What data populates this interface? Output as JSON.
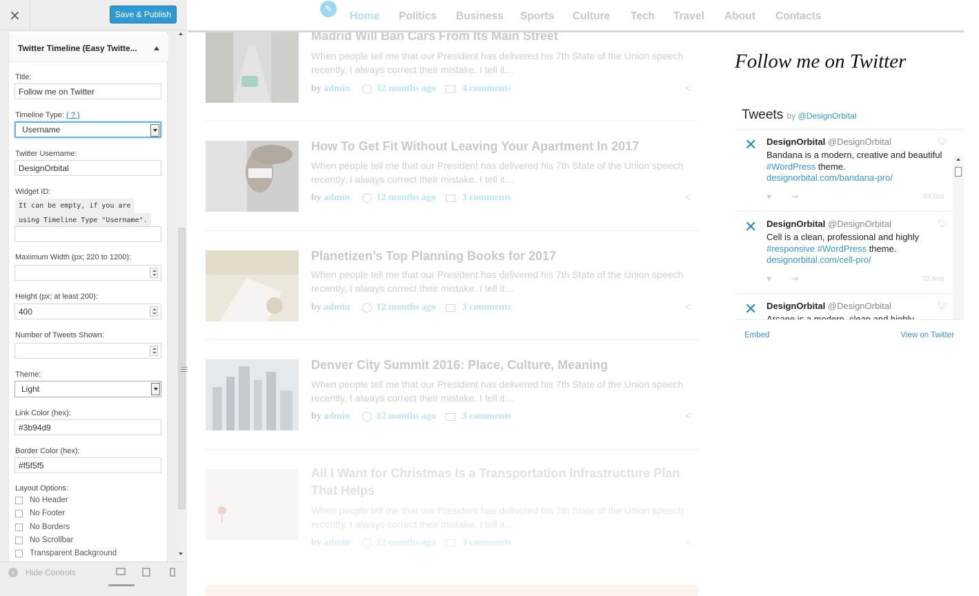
{
  "header": {
    "close_glyph": "×",
    "publish_label": "Save & Publish"
  },
  "widget": {
    "title": "Twitter Timeline (Easy Twitte...",
    "fields": {
      "title_label": "Title:",
      "title_value": "Follow me on Twitter",
      "timeline_type_label": "Timeline Type:",
      "timeline_type_help": "( ? )",
      "timeline_type_value": "Username",
      "username_label": "Twitter Username:",
      "username_value": "DesignOrbital",
      "widget_id_label": "Widget ID:",
      "widget_id_desc_1": "It can be empty, if you are",
      "widget_id_desc_2": "using Timeline Type \"Username\".",
      "widget_id_value": "",
      "max_width_label": "Maximum Width (px; 220 to 1200):",
      "max_width_value": "",
      "height_label": "Height (px; at least 200):",
      "height_value": "400",
      "tweets_label": "Number of Tweets Shown:",
      "tweets_value": "",
      "theme_label": "Theme:",
      "theme_value": "Light",
      "link_color_label": "Link Color (hex):",
      "link_color_value": "#3b94d9",
      "border_color_label": "Border Color (hex):",
      "border_color_value": "#f5f5f5",
      "layout_label": "Layout Options:"
    },
    "layout_options": [
      "No Header",
      "No Footer",
      "No Borders",
      "No Scrollbar",
      "Transparent Background"
    ]
  },
  "footer": {
    "hide_controls": "Hide Controls"
  },
  "nav": {
    "items": [
      "Home",
      "Politics",
      "Business",
      "Sports",
      "Culture",
      "Tech",
      "Travel",
      "About",
      "Contacts"
    ],
    "active": "Home"
  },
  "posts": [
    {
      "title": "Madrid Will Ban Cars From Its Main Street",
      "excerpt": "When people tell me that our President has delivered his 7th State of the Union speech recently, I always correct their mistake.  I tell it…",
      "by": "by",
      "author": "admin",
      "time": "12 months ago",
      "comments": "4 comments"
    },
    {
      "title": "How To Get Fit Without Leaving Your Apartment In 2017",
      "excerpt": "When people tell me that our President has delivered his 7th State of the Union speech recently, I always correct their mistake.  I tell it…",
      "by": "by",
      "author": "admin",
      "time": "12 months ago",
      "comments": "3 comments"
    },
    {
      "title": "Planetizen’s Top Planning Books for 2017",
      "excerpt": "When people tell me that our President has delivered his 7th State of the Union speech recently, I always correct their mistake.  I tell it…",
      "by": "by",
      "author": "admin",
      "time": "12 months ago",
      "comments": "3 comments"
    },
    {
      "title": "Denver City Summit 2016: Place, Culture, Meaning",
      "excerpt": "When people tell me that our President has delivered his 7th State of the Union speech recently, I always correct their mistake.  I tell it…",
      "by": "by",
      "author": "admin",
      "time": "12 months ago",
      "comments": "3 comments"
    },
    {
      "title": "All I Want for Christmas Is a Transportation Infrastructure Plan That Helps",
      "excerpt": "When people tell me that our President has delivered his 7th State of the Union speech recently, I always correct their mistake.  I tell it…",
      "by": "by",
      "author": "admin",
      "time": "12 months ago",
      "comments": "3 comments"
    }
  ],
  "twitter": {
    "section_title": "Follow me on Twitter",
    "header": "Tweets",
    "by_prefix": "by",
    "by_handle": "@DesignOrbital",
    "tweets": [
      {
        "name": "DesignOrbital",
        "handle": "@DesignOrbital",
        "text_1": "Bandana is a modern, creative and beautiful",
        "tag_1": "#WordPress",
        "text_2": " theme.",
        "link": "designorbital.com/bandana-pro/",
        "date": "04 Oct"
      },
      {
        "name": "DesignOrbital",
        "handle": "@DesignOrbital",
        "text_1": "Cell is a clean, professional and highly",
        "tag_1": "#responsive #WordPress",
        "text_2": " theme.",
        "link": "designorbital.com/cell-pro/",
        "date": "22 Aug"
      },
      {
        "name": "DesignOrbital",
        "handle": "@DesignOrbital",
        "text_1": "Arcane is a modern, clean and highly",
        "tag_1": "",
        "text_2": "",
        "link": "",
        "date": ""
      }
    ],
    "embed": "Embed",
    "view_on": "View on Twitter"
  },
  "colors": {
    "accent": "#2e9ad0",
    "twitter_link": "#3b94d9",
    "nav_active": "#aee2f4"
  },
  "icons": [
    "close-icon",
    "caret-up-icon",
    "select-arrow-icon",
    "spinner-icon",
    "hide-controls-icon",
    "desktop-icon",
    "tablet-icon",
    "mobile-icon",
    "pencil-icon",
    "clock-icon",
    "comment-icon",
    "share-icon",
    "twitter-bird-icon",
    "heart-icon",
    "retweet-icon"
  ]
}
